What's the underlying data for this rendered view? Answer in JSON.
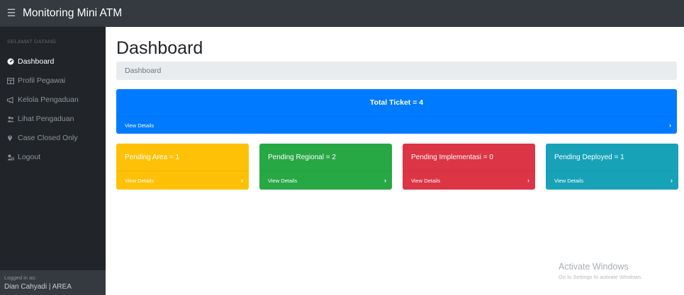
{
  "app": {
    "title": "Monitoring Mini ATM"
  },
  "sidebar": {
    "heading": "SELAMAT DATANG",
    "items": [
      {
        "label": "Dashboard",
        "icon": "dashboard-icon",
        "active": true
      },
      {
        "label": "Profil Pegawai",
        "icon": "table-icon",
        "active": false
      },
      {
        "label": "Kelola Pengaduan",
        "icon": "bullhorn-icon",
        "active": false
      },
      {
        "label": "Lihat Pengaduan",
        "icon": "users-icon",
        "active": false
      },
      {
        "label": "Case Closed Only",
        "icon": "map-marker-icon",
        "active": false
      },
      {
        "label": "Logout",
        "icon": "user-cog-icon",
        "active": false
      }
    ],
    "footer": {
      "logged_in_label": "Logged in as:",
      "user": "Dian Cahyadi | AREA"
    }
  },
  "main": {
    "title": "Dashboard",
    "breadcrumb": "Dashboard",
    "total_card": {
      "text": "Total Ticket = 4",
      "details": "View Details",
      "color": "#007bff"
    },
    "cards": [
      {
        "text": "Pending Area = 1",
        "details": "View Details",
        "color": "#ffc107"
      },
      {
        "text": "Pending Regional = 2",
        "details": "View Details",
        "color": "#28a745"
      },
      {
        "text": "Pending Implementasi = 0",
        "details": "View Details",
        "color": "#dc3545"
      },
      {
        "text": "Pending Deployed = 1",
        "details": "View Details",
        "color": "#17a2b8"
      }
    ]
  },
  "watermark": {
    "line1": "Activate Windows",
    "line2": "Go to Settings to activate Windows."
  }
}
